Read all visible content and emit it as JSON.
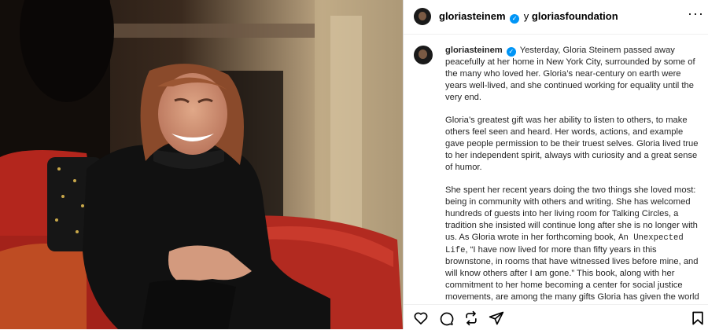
{
  "post": {
    "author": "gloriasteinem",
    "connector": "y",
    "coauthor": "gloriasfoundation",
    "more_label": "···",
    "verified_glyph": "✓",
    "caption": {
      "p1": "Yesterday, Gloria Steinem passed away peacefully at her home in New York City, surrounded by some of the many who loved her. Gloria’s near-century on earth were years well-lived, and she continued working for equality until the very end.",
      "p2": "Gloria’s greatest gift was her ability to listen to others, to make others feel seen and heard. Her words, actions, and example gave people permission to be their truest selves. Gloria lived true to her independent spirit, always with curiosity and a great sense of humor.",
      "p3_before": "She spent her recent years doing the two things she loved most: being in community with others and writing. She has welcomed hundreds of guests into her living room for Talking Circles, a tradition she insisted will continue long after she is no longer with us. As Gloria wrote in her forthcoming book, ",
      "p3_book": "An Unexpected Life",
      "p3_after": ", “I have now lived for more than fifty years in this brownstone, in rooms that have witnessed lives before mine, and will know others after I am gone.” This book, along with her commitment to her home becoming a center for social justice movements, are among the many gifts Gloria has given the world with the hope they have ripple effects for generations to come."
    }
  },
  "icons": {
    "like": "heart-icon",
    "comment": "comment-icon",
    "share": "repost-icon",
    "send": "send-icon",
    "save": "bookmark-icon",
    "verified": "verified-badge-icon",
    "more": "more-options-icon"
  },
  "colors": {
    "verified": "#0095f6",
    "text": "#262626",
    "border": "#dbdbdb"
  }
}
